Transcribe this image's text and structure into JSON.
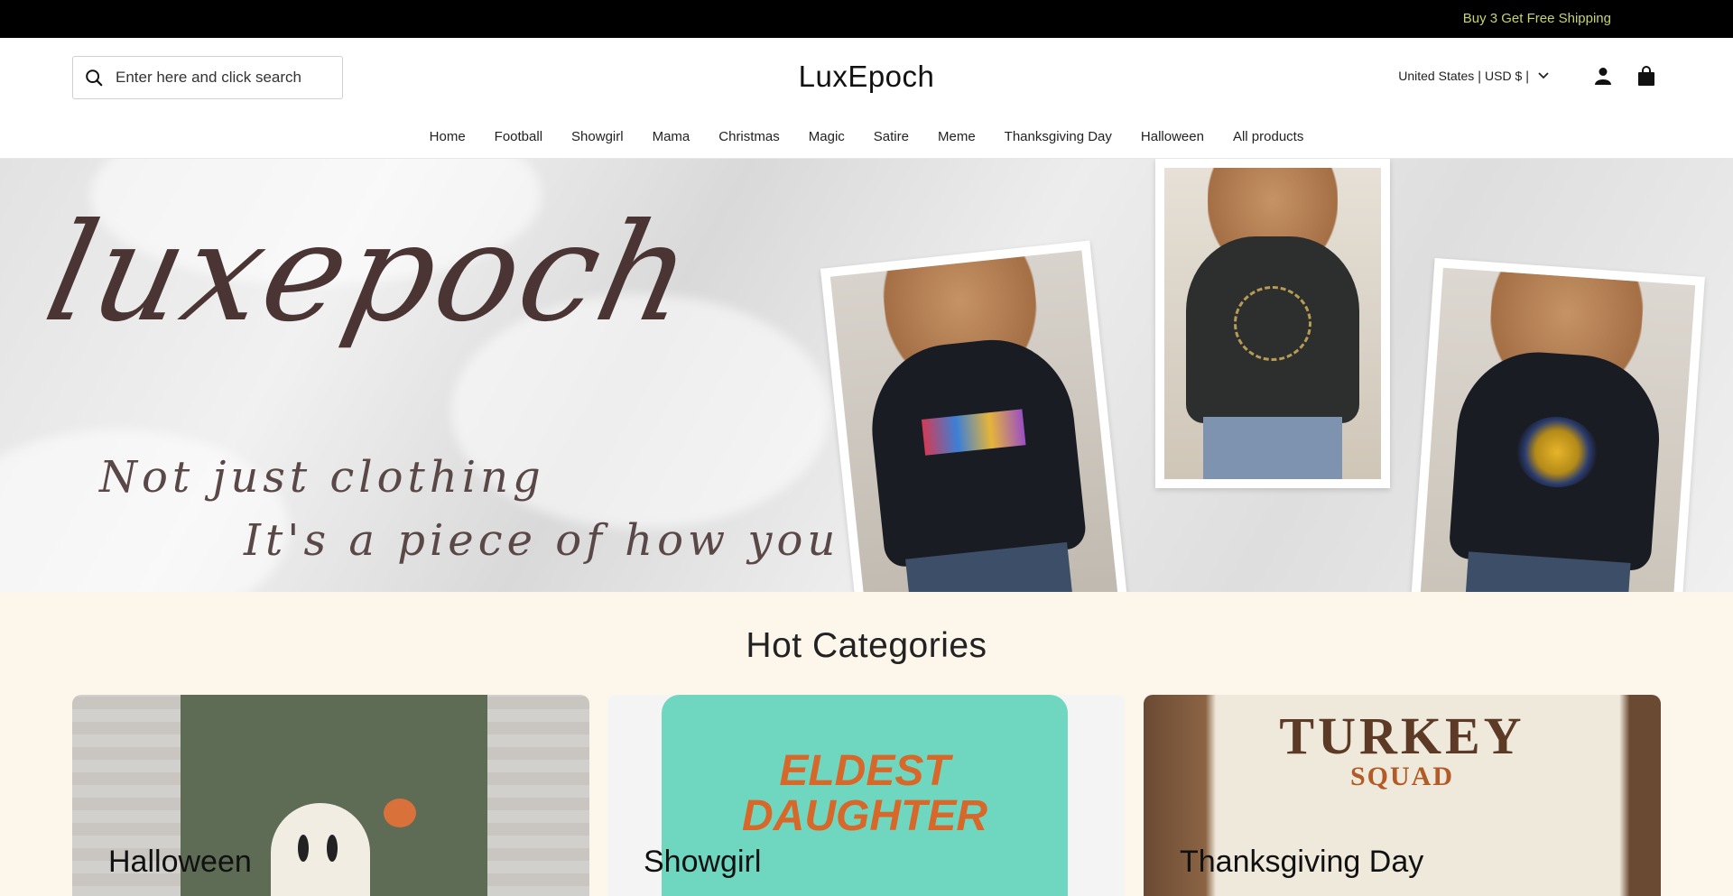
{
  "announcement": {
    "text": "Buy 3 Get Free Shipping"
  },
  "header": {
    "search_placeholder": "Enter here and click search",
    "logo": "LuxEpoch",
    "locale": "United States❘USD $❘",
    "icons": [
      "search-icon",
      "chevron-down-icon",
      "account-icon",
      "cart-icon"
    ]
  },
  "nav": {
    "items": [
      {
        "label": "Home"
      },
      {
        "label": "Football"
      },
      {
        "label": "Showgirl"
      },
      {
        "label": "Mama"
      },
      {
        "label": "Christmas"
      },
      {
        "label": "Magic"
      },
      {
        "label": "Satire"
      },
      {
        "label": "Meme"
      },
      {
        "label": "Thanksgiving Day"
      },
      {
        "label": "Halloween"
      },
      {
        "label": "All products"
      }
    ]
  },
  "hero": {
    "script_title": "luxepoch",
    "tagline_line1": "Not just clothing",
    "tagline_line2": "It's a piece of how you live"
  },
  "categories": {
    "heading": "Hot Categories",
    "cards": [
      {
        "label": "Halloween"
      },
      {
        "label": "Showgirl",
        "art_text_1": "ELDEST",
        "art_text_2": "DAUGHTER"
      },
      {
        "label": "Thanksgiving Day",
        "art_text_1": "TURKEY",
        "art_text_2": "SQUAD"
      }
    ]
  },
  "colors": {
    "announcement_bg": "#000000",
    "announcement_text": "#c9d36b",
    "categories_bg": "#fdf6ea"
  }
}
